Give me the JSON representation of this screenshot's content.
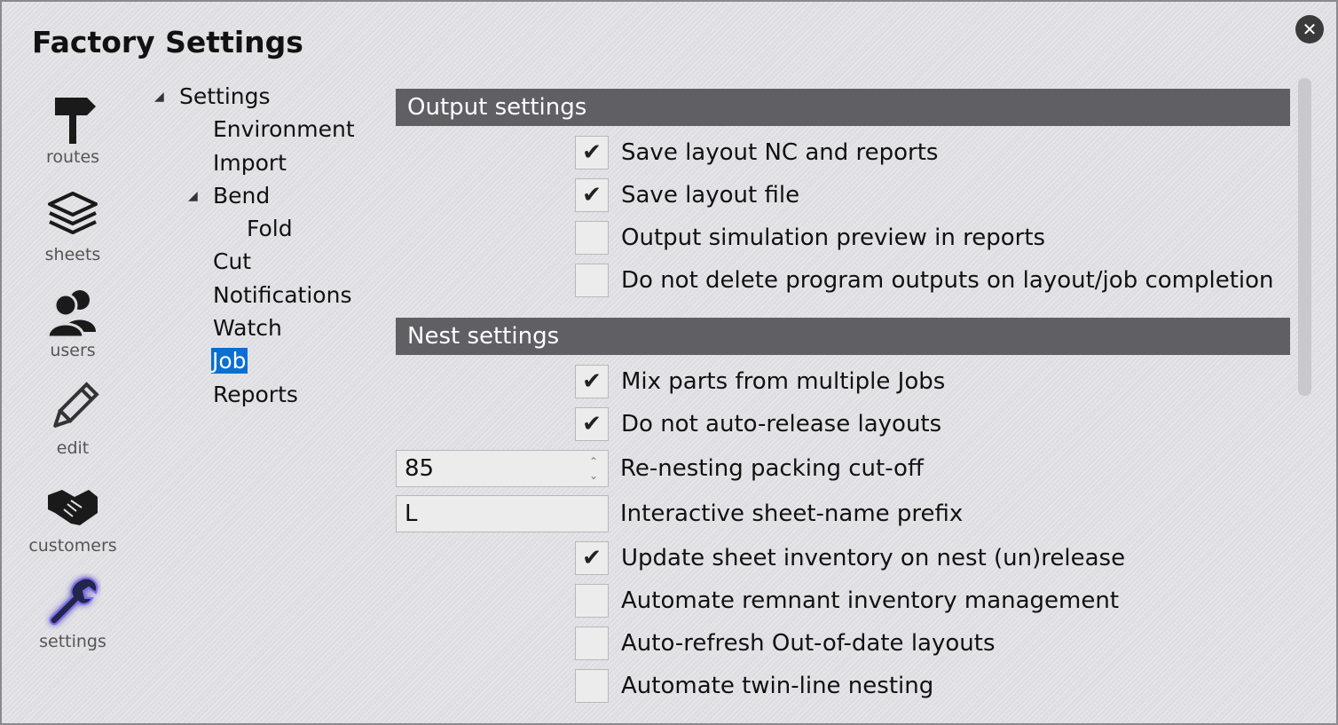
{
  "window": {
    "title": "Factory Settings",
    "close_icon": "close-icon"
  },
  "nav": [
    {
      "label": "routes",
      "icon": "signpost-icon"
    },
    {
      "label": "sheets",
      "icon": "stacked-sheets-icon"
    },
    {
      "label": "users",
      "icon": "users-icon"
    },
    {
      "label": "edit",
      "icon": "pencil-icon"
    },
    {
      "label": "customers",
      "icon": "handshake-icon"
    },
    {
      "label": "settings",
      "icon": "wrench-icon",
      "active": true,
      "glow_color": "#7b6cf0"
    }
  ],
  "tree": {
    "root": "Settings",
    "items": [
      "Environment",
      "Import",
      "Bend",
      "Fold",
      "Cut",
      "Notifications",
      "Watch",
      "Job",
      "Reports"
    ],
    "selected": "Job",
    "selected_color": "#0a6fd0"
  },
  "output_settings": {
    "header": "Output settings",
    "options": [
      {
        "label": "Save layout NC and reports",
        "checked": true
      },
      {
        "label": "Save layout file",
        "checked": true
      },
      {
        "label": "Output simulation preview in reports",
        "checked": false
      },
      {
        "label": "Do not delete program outputs on layout/job completion",
        "checked": false
      }
    ]
  },
  "nest_settings": {
    "header": "Nest settings",
    "options_top": [
      {
        "label": "Mix parts from multiple Jobs",
        "checked": true
      },
      {
        "label": "Do not auto-release layouts",
        "checked": true
      }
    ],
    "packing_cutoff": {
      "value": "85",
      "label": "Re-nesting packing cut-off"
    },
    "sheet_prefix": {
      "value": "L",
      "label": "Interactive sheet-name prefix"
    },
    "options_bottom": [
      {
        "label": "Update sheet inventory on nest (un)release",
        "checked": true
      },
      {
        "label": "Automate remnant inventory management",
        "checked": false
      },
      {
        "label": "Auto-refresh Out-of-date layouts",
        "checked": false
      },
      {
        "label": "Automate twin-line nesting",
        "checked": false
      }
    ]
  },
  "colors": {
    "header_bg": "#5f5f64",
    "background": "#dedee2"
  }
}
